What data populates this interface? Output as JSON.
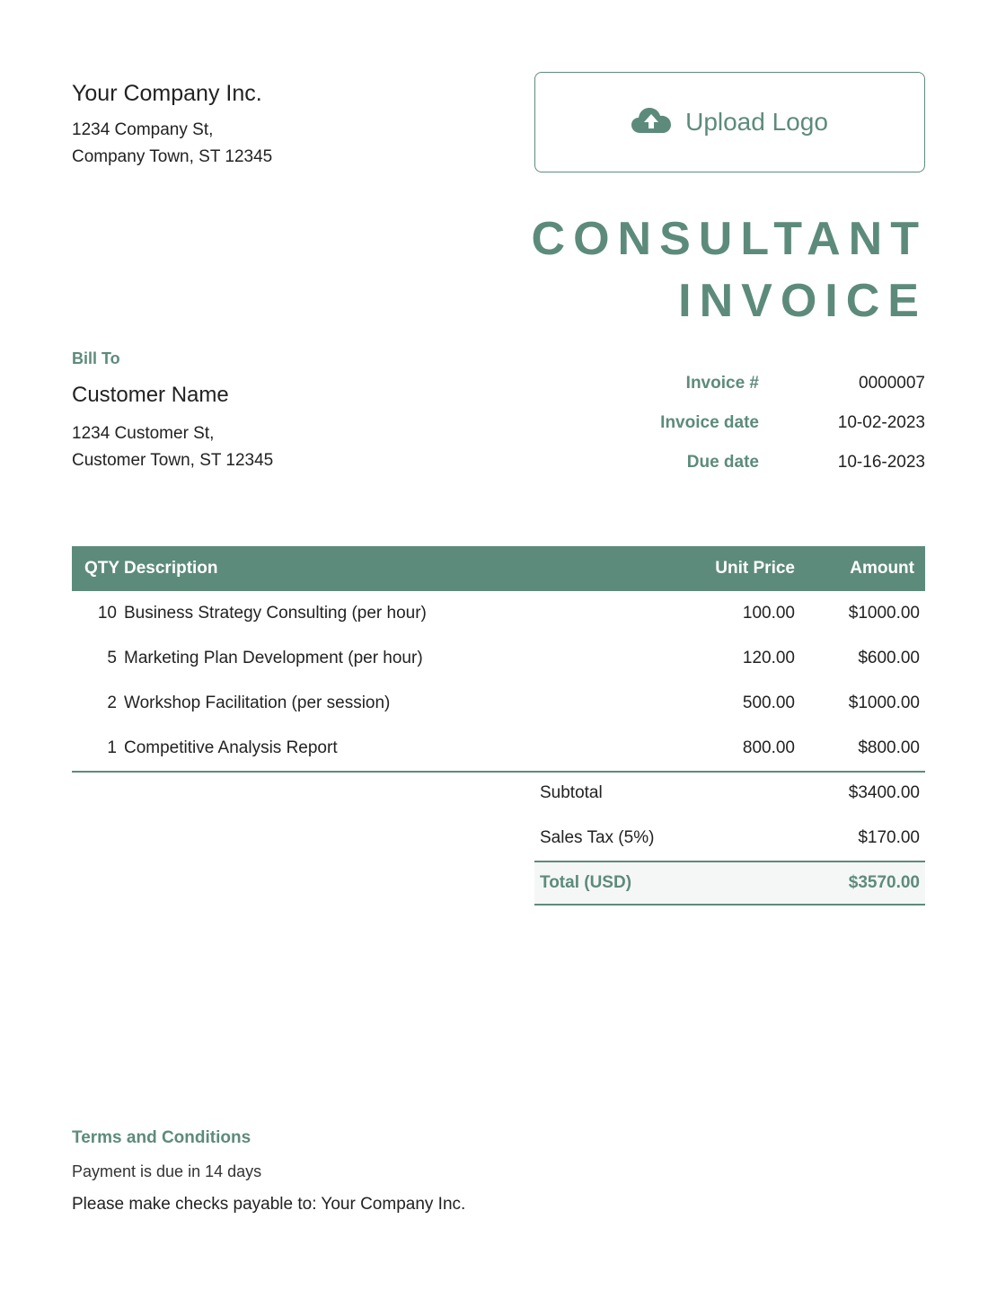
{
  "company": {
    "name": "Your Company Inc.",
    "address_line1": "1234 Company St,",
    "address_line2": "Company Town, ST 12345"
  },
  "upload_logo": {
    "icon": "cloud-upload-icon",
    "label": "Upload Logo"
  },
  "title": {
    "line1": "CONSULTANT",
    "line2": "INVOICE"
  },
  "bill_to": {
    "label": "Bill To",
    "customer_name": "Customer Name",
    "address_line1": "1234 Customer St,",
    "address_line2": "Customer Town, ST 12345"
  },
  "meta": [
    {
      "label": "Invoice #",
      "value": "0000007"
    },
    {
      "label": "Invoice date",
      "value": "10-02-2023"
    },
    {
      "label": "Due date",
      "value": "10-16-2023"
    }
  ],
  "table": {
    "headers": {
      "qty": "QTY",
      "description": "Description",
      "unit_price": "Unit Price",
      "amount": "Amount"
    },
    "rows": [
      {
        "qty": "10",
        "description": "Business Strategy Consulting (per hour)",
        "unit_price": "100.00",
        "amount": "$1000.00"
      },
      {
        "qty": "5",
        "description": "Marketing Plan Development (per hour)",
        "unit_price": "120.00",
        "amount": "$600.00"
      },
      {
        "qty": "2",
        "description": "Workshop Facilitation (per session)",
        "unit_price": "500.00",
        "amount": "$1000.00"
      },
      {
        "qty": "1",
        "description": "Competitive Analysis Report",
        "unit_price": "800.00",
        "amount": "$800.00"
      }
    ]
  },
  "totals": {
    "subtotal_label": "Subtotal",
    "subtotal_value": "$3400.00",
    "tax_label": "Sales Tax (5%)",
    "tax_value": "$170.00",
    "total_label": "Total (USD)",
    "total_value": "$3570.00"
  },
  "terms": {
    "label": "Terms and Conditions",
    "line1": "Payment is due in 14 days",
    "line2": "Please make checks payable to: Your Company Inc."
  },
  "colors": {
    "accent": "#5d8b7b",
    "total_row_bg": "#f5f7f6"
  }
}
